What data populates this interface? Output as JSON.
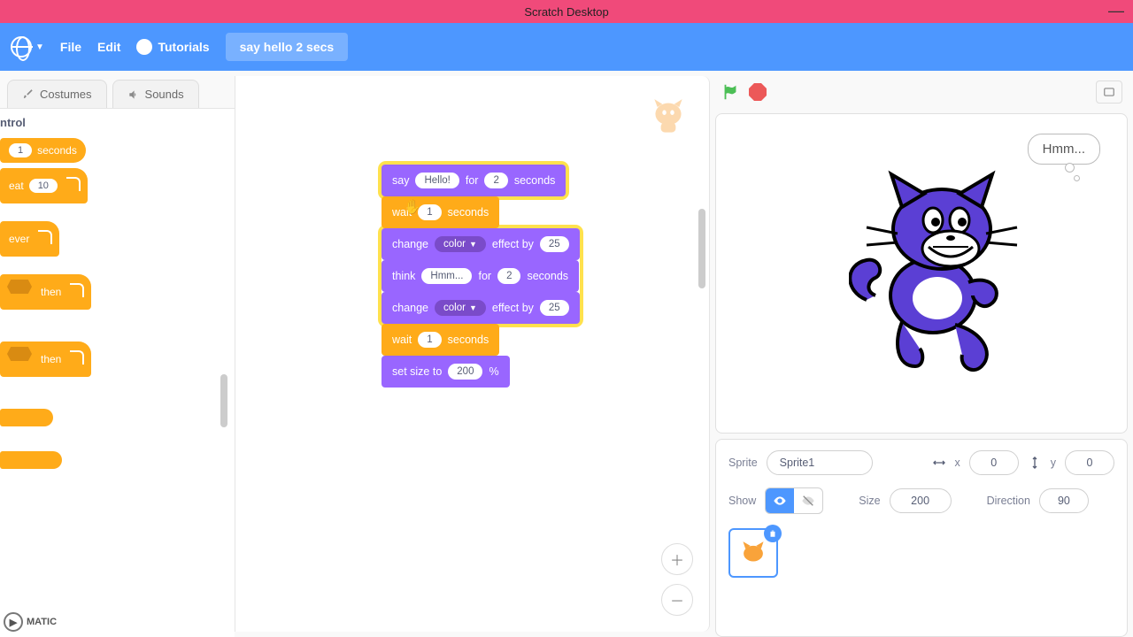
{
  "titlebar": {
    "title": "Scratch Desktop",
    "minimize": "—"
  },
  "menubar": {
    "file": "File",
    "edit": "Edit",
    "tutorials": "Tutorials",
    "project_name": "say hello 2 secs"
  },
  "tabs": {
    "costumes": "Costumes",
    "sounds": "Sounds"
  },
  "palette": {
    "category": "ntrol",
    "wait_label": "seconds",
    "wait_val": "1",
    "repeat_prefix": "eat",
    "repeat_val": "10",
    "forever": "ever",
    "ifthen1": "then",
    "ifthen2": "then"
  },
  "script": {
    "b1_say": "say",
    "b1_text": "Hello!",
    "b1_for": "for",
    "b1_secs": "2",
    "b1_seconds": "seconds",
    "b2_wait": "wait",
    "b2_val": "1",
    "b2_seconds": "seconds",
    "b3_change": "change",
    "b3_effect": "color",
    "b3_by": "effect by",
    "b3_val": "25",
    "b4_think": "think",
    "b4_text": "Hmm...",
    "b4_for": "for",
    "b4_secs": "2",
    "b4_seconds": "seconds",
    "b5_change": "change",
    "b5_effect": "color",
    "b5_by": "effect by",
    "b5_val": "25",
    "b6_wait": "wait",
    "b6_val": "1",
    "b6_seconds": "seconds",
    "b7_size": "set size to",
    "b7_val": "200",
    "b7_pct": "%"
  },
  "stage": {
    "think_text": "Hmm..."
  },
  "sprite_info": {
    "sprite_label": "Sprite",
    "sprite_name": "Sprite1",
    "x_label": "x",
    "x_val": "0",
    "y_label": "y",
    "y_val": "0",
    "show_label": "Show",
    "size_label": "Size",
    "size_val": "200",
    "dir_label": "Direction",
    "dir_val": "90"
  },
  "watermark": {
    "text": "MATIC"
  },
  "colors": {
    "looks": "#9966ff",
    "control": "#ffab19",
    "menu": "#4d97ff",
    "title": "#f04a7a"
  }
}
